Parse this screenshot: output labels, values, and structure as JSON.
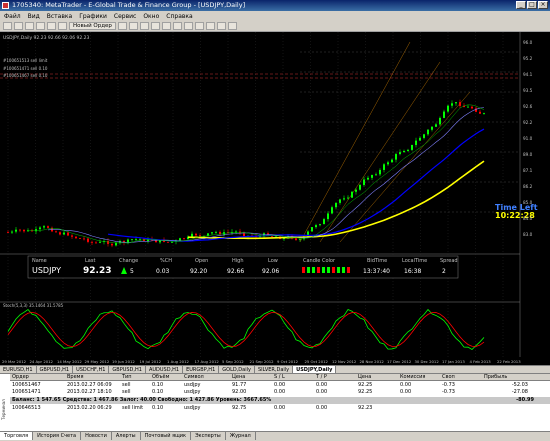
{
  "window": {
    "title": "1705340: MetaTrader - E-Global Trade & Finance Group - [USDJPY,Daily]"
  },
  "menu": [
    "Файл",
    "Вид",
    "Вставка",
    "Графики",
    "Сервис",
    "Окно",
    "Справка"
  ],
  "toolbar": {
    "new_order_label": "Новый Ордер",
    "timeframes": [
      "M1",
      "M5",
      "M15",
      "M30",
      "H1",
      "H4",
      "D1",
      "W1",
      "MN"
    ]
  },
  "chart": {
    "symbol_label": "USDJPY,Daily",
    "ohlc_text": "USDJPY,Daily  92.23 92.66 92.06 92.23",
    "sell_limit_1": "#100651513 sell limit",
    "sell_1": "#100651471 sell 0.10",
    "sell_2": "#100651467 sell 0.10",
    "price_labels": [
      "96.0",
      "95.2",
      "94.1",
      "93.5",
      "92.6",
      "92.2",
      "91.0",
      "89.0",
      "87.1",
      "86.2",
      "85.0",
      "84.0",
      "83.0"
    ],
    "time_left_label": "Time Left",
    "time_left_value": "10:22:28",
    "indicator_label": "Stoch(5,3,3) 35.1464 31.5785",
    "x_labels": [
      "29 Mar 2012",
      "24 Apr 2012",
      "14 May 2012",
      "29 May 2012",
      "19 Jun 2012",
      "19 Jul 2012",
      "1 Aug 2012",
      "17 Aug 2012",
      "5 Sep 2012",
      "21 Sep 2012",
      "9 Oct 2012",
      "25 Oct 2012",
      "12 Nov 2012",
      "28 Nov 2012",
      "17 Dec 2012",
      "30 Dec 2012",
      "17 Jan 2013",
      "4 Feb 2013",
      "22 Feb 2013"
    ],
    "colors": {
      "up": "#00ff00",
      "down": "#ff0000",
      "ma_yellow": "#ffff00",
      "ma_blue": "#0000ff",
      "text": "#c0c0c0"
    }
  },
  "info_panel": {
    "headers": [
      "Name",
      "Last",
      "Change",
      "%CH",
      "Open",
      "High",
      "Low",
      "Candle Color",
      "BidTime",
      "LocalTime",
      "Spread"
    ],
    "values": [
      "USDJPY",
      "92.23",
      "",
      "0.03",
      "92.20",
      "92.66",
      "92.06",
      "",
      "13:37:40",
      "16:38",
      "2"
    ],
    "change_value": "5"
  },
  "chart_tabs": [
    "EURUSD,H1",
    "GBPUSD,H1",
    "USDCHF,H1",
    "GBPUSD,H1",
    "AUDUSD,H1",
    "EURGBP,H1",
    "GOLD,Daily",
    "SILVER,Daily",
    "USDJPY,Daily"
  ],
  "terminal": {
    "headers": [
      "Ордер",
      "Время",
      "Тип",
      "Объём",
      "Символ",
      "Цена",
      "S / L",
      "T / P",
      "Цена",
      "Комиссия",
      "Своп",
      "Прибыль"
    ],
    "rows": [
      [
        "100651467",
        "2013.02.27 06:09",
        "sell",
        "0.10",
        "usdjpy",
        "91.77",
        "0.00",
        "0.00",
        "92.25",
        "0.00",
        "-0.73",
        "-52.03"
      ],
      [
        "100651471",
        "2013.02.27 18:10",
        "sell",
        "0.10",
        "usdjpy",
        "92.00",
        "0.00",
        "0.00",
        "92.25",
        "0.00",
        "-0.73",
        "-27.08"
      ]
    ],
    "balance_text": "Баланс: 1 547.65  Средства: 1 467.86  Залог: 40.00  Свободно: 1 427.86  Уровень: 3667.65%",
    "balance_profit": "-80.99",
    "pending_row": [
      "100646513",
      "2013.02.20 06:29",
      "sell limit",
      "0.10",
      "usdjpy",
      "92.75",
      "0.00",
      "0.00",
      "92.23",
      "",
      "",
      ""
    ],
    "tabs": [
      "Торговля",
      "История Счета",
      "Новости",
      "Алерты",
      "Почтовый ящик",
      "Эксперты",
      "Журнал"
    ],
    "side_label": "Терминал"
  },
  "status": {
    "help": "Для справки, нажмите F1",
    "profile": "Default",
    "traffic": "164/35 kb"
  }
}
